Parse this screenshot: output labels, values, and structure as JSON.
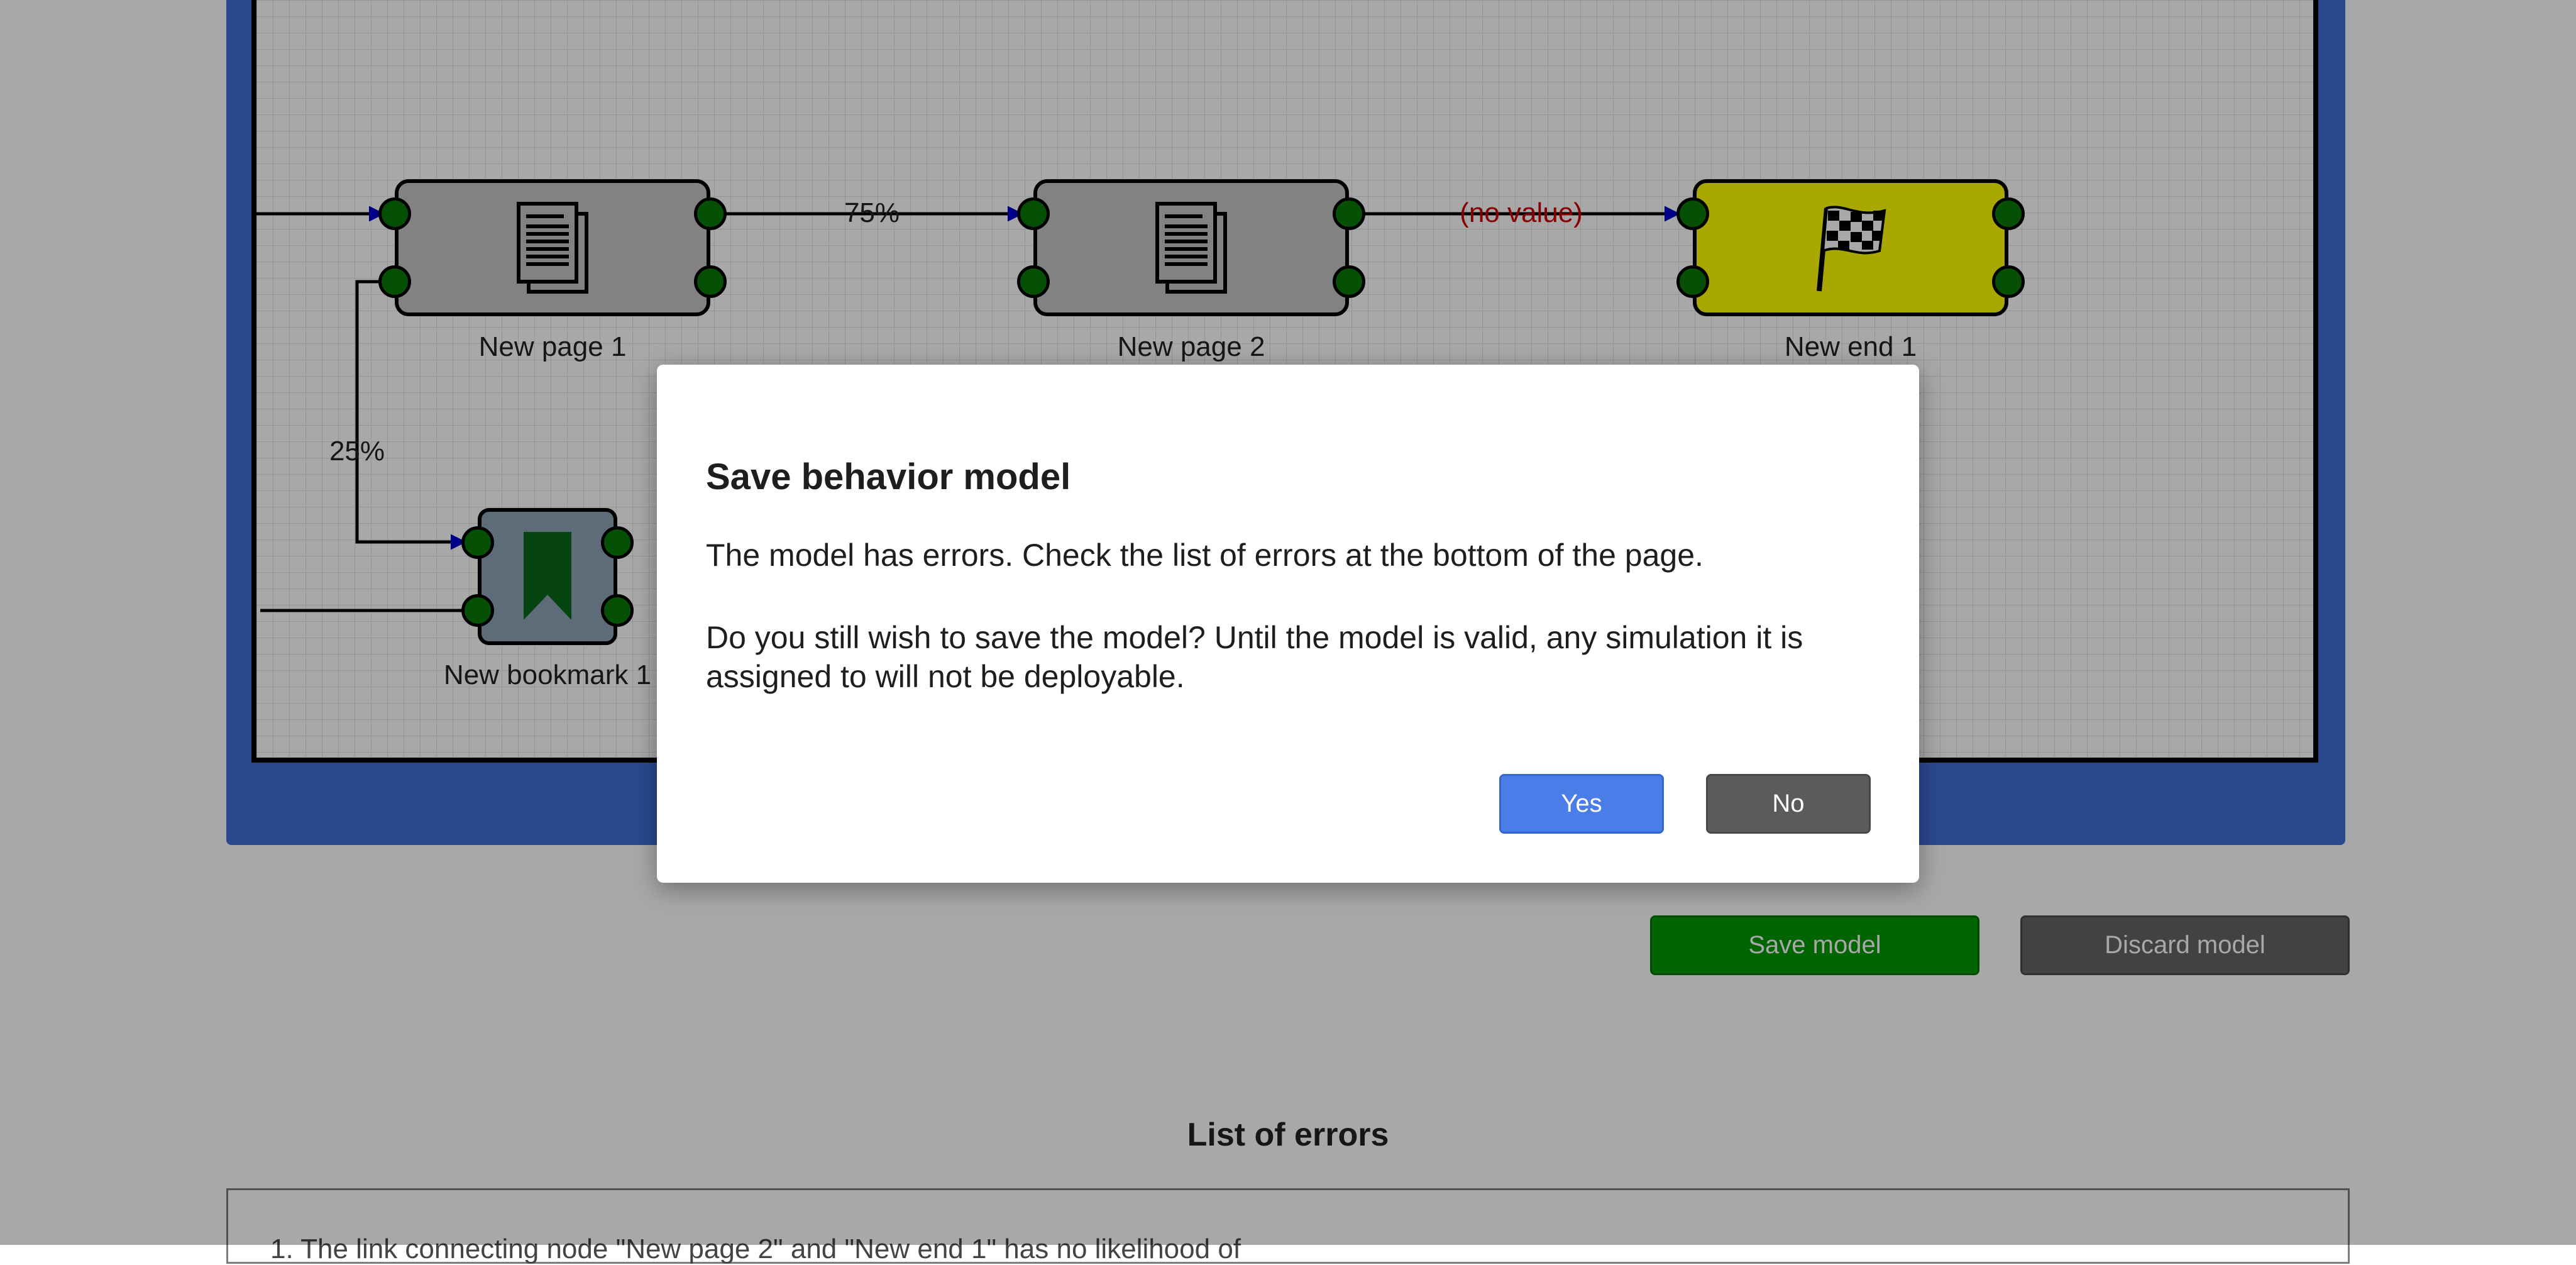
{
  "diagram": {
    "nodes": [
      {
        "id": "page1",
        "label": "New page 1",
        "icon": "document-icon"
      },
      {
        "id": "page2",
        "label": "New page 2",
        "icon": "document-icon"
      },
      {
        "id": "end1",
        "label": "New end 1",
        "icon": "checkered-flag-icon"
      },
      {
        "id": "bookmark1",
        "label": "New bookmark 1",
        "icon": "bookmark-icon"
      }
    ],
    "edges": [
      {
        "from": "page1",
        "to": "page2",
        "label": "75%"
      },
      {
        "from": "page2",
        "to": "end1",
        "label": "(no value)"
      },
      {
        "from": "page1",
        "to": "bookmark1",
        "label": "25%"
      }
    ]
  },
  "colors": {
    "editor_frame": "#3f6fd9",
    "page_node": "#c5c5c5",
    "end_node": "#ffff00",
    "port": "#0a7a0a",
    "error_label": "#d00000",
    "save_button": "#009a00",
    "discard_button": "#646464",
    "yes_button": "#4a7de8",
    "no_button": "#5b5b5b"
  },
  "actions": {
    "save_label": "Save model",
    "discard_label": "Discard model"
  },
  "errors": {
    "heading": "List of errors",
    "first_item_partial": "1. The link connecting node \"New page 2\" and \"New end 1\" has no likelihood of"
  },
  "dialog": {
    "title": "Save behavior model",
    "message1": "The model has errors. Check the list of errors at the bottom of the page.",
    "message2": "Do you still wish to save the model? Until the model is valid, any simulation it is assigned to will not be deployable.",
    "yes_label": "Yes",
    "no_label": "No"
  }
}
